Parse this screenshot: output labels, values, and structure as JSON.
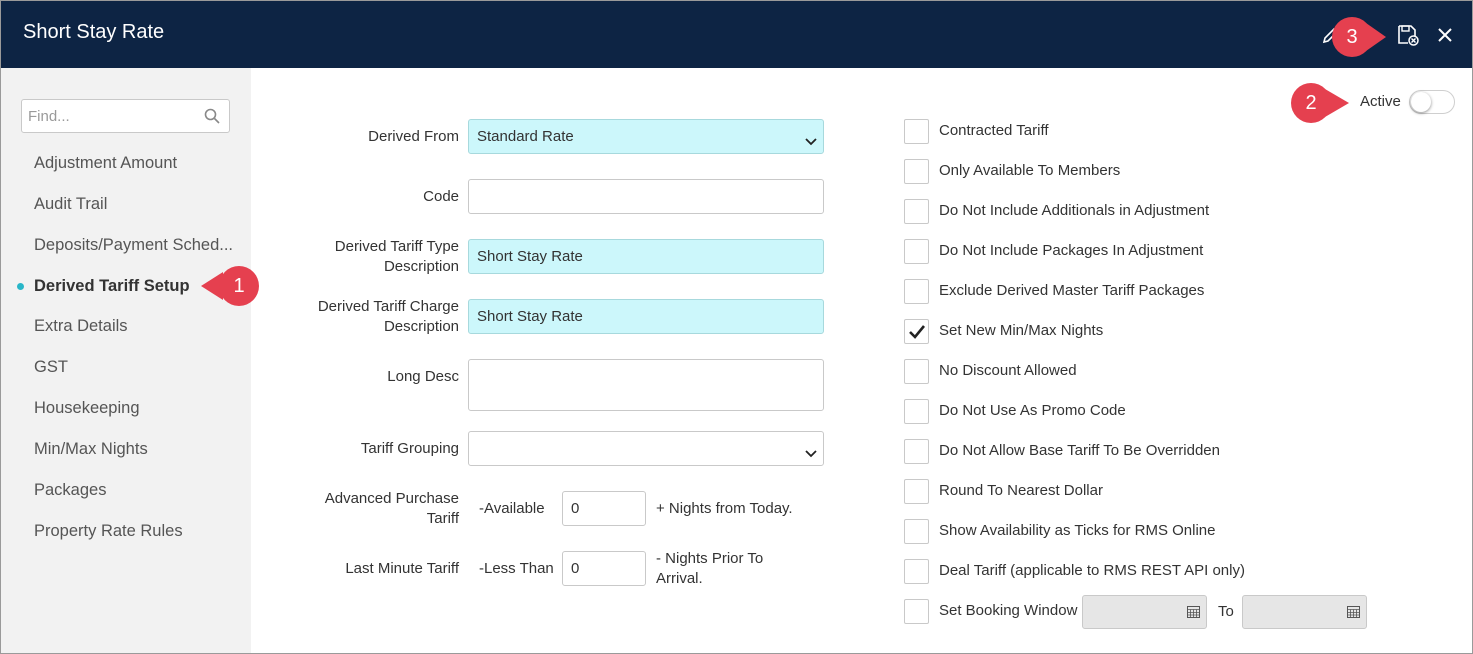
{
  "window": {
    "title": "Short Stay Rate"
  },
  "header_icons": {
    "edit": "pencil-icon",
    "save_exit": "save-close-icon",
    "close": "close-icon"
  },
  "callouts": {
    "c1": "1",
    "c2": "2",
    "c3": "3"
  },
  "colors": {
    "header_bg": "#0d2444",
    "callout": "#e5404f",
    "highlight_field": "#ccf7fb",
    "nav_dot": "#29b6c8"
  },
  "sidebar": {
    "search_placeholder": "Find...",
    "items": [
      {
        "label": "Adjustment Amount"
      },
      {
        "label": "Audit Trail"
      },
      {
        "label": "Deposits/Payment Sched..."
      },
      {
        "label": "Derived Tariff Setup",
        "active": true
      },
      {
        "label": "Extra Details"
      },
      {
        "label": "GST"
      },
      {
        "label": "Housekeeping"
      },
      {
        "label": "Min/Max Nights"
      },
      {
        "label": "Packages"
      },
      {
        "label": "Property Rate Rules"
      }
    ]
  },
  "form": {
    "derived_from": {
      "label": "Derived From",
      "value": "Standard Rate"
    },
    "code": {
      "label": "Code",
      "value": ""
    },
    "type_desc": {
      "label_1": "Derived Tariff Type",
      "label_2": "Description",
      "value": "Short Stay Rate"
    },
    "charge_desc": {
      "label_1": "Derived Tariff Charge",
      "label_2": "Description",
      "value": "Short Stay Rate"
    },
    "long_desc": {
      "label": "Long Desc",
      "value": ""
    },
    "tariff_grouping": {
      "label": "Tariff Grouping",
      "value": ""
    },
    "advanced_purchase": {
      "label_1": "Advanced Purchase",
      "label_2": "Tariff",
      "prefix": "-Available",
      "value": "0",
      "suffix": "+ Nights from Today."
    },
    "last_minute": {
      "label": "Last Minute Tariff",
      "prefix": "-Less Than",
      "value": "0",
      "suffix_1": "- Nights Prior To",
      "suffix_2": "Arrival."
    }
  },
  "active": {
    "label": "Active",
    "on": false
  },
  "checkboxes": [
    {
      "label": "Contracted Tariff",
      "checked": false
    },
    {
      "label": "Only Available To Members",
      "checked": false
    },
    {
      "label": "Do Not Include Additionals in Adjustment",
      "checked": false
    },
    {
      "label": "Do Not Include Packages In Adjustment",
      "checked": false
    },
    {
      "label": "Exclude Derived Master Tariff Packages",
      "checked": false
    },
    {
      "label": "Set New Min/Max Nights",
      "checked": true
    },
    {
      "label": "No Discount Allowed",
      "checked": false
    },
    {
      "label": "Do Not Use As Promo Code",
      "checked": false
    },
    {
      "label": "Do Not Allow Base Tariff To Be Overridden",
      "checked": false
    },
    {
      "label": "Round To Nearest Dollar",
      "checked": false
    },
    {
      "label": "Show Availability as Ticks for RMS Online",
      "checked": false
    },
    {
      "label": "Deal Tariff (applicable to RMS REST API only)",
      "checked": false
    },
    {
      "label": "Set Booking Window",
      "checked": false
    }
  ],
  "booking_window": {
    "to_label": "To",
    "from_value": "",
    "to_value": ""
  }
}
